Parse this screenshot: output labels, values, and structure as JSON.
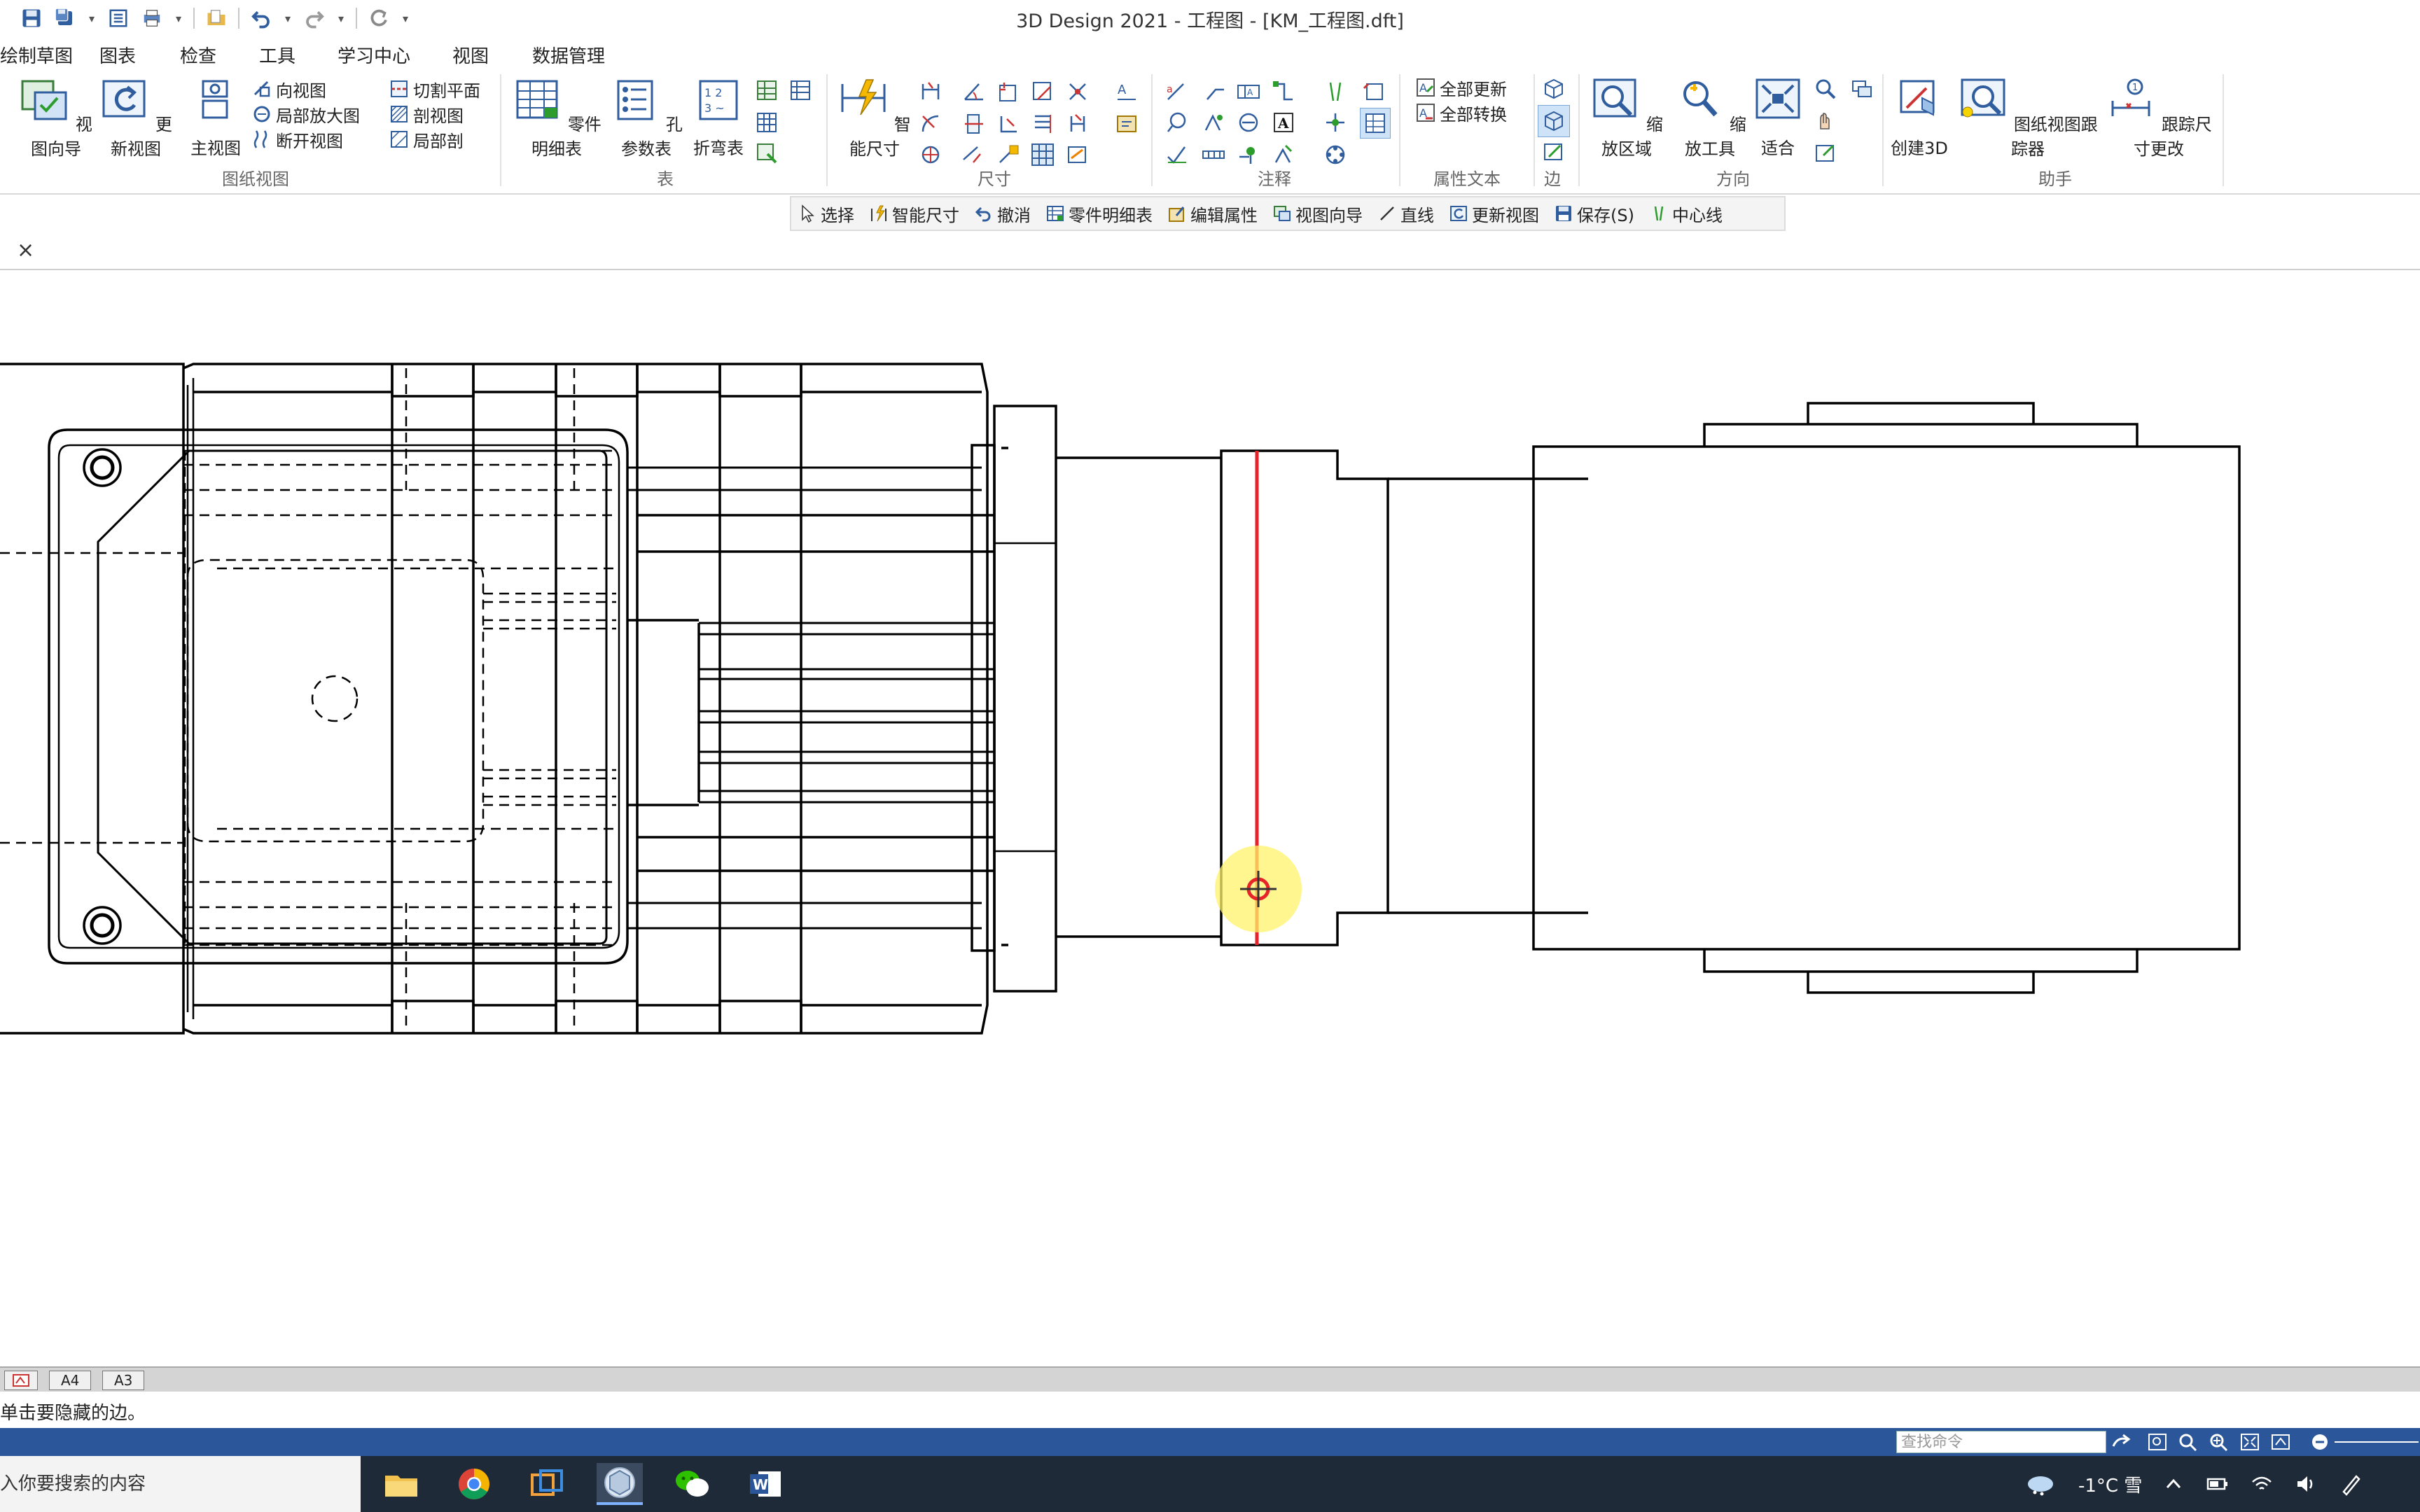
{
  "window": {
    "title": "3D Design 2021 - 工程图 - [KM_工程图.dft]"
  },
  "quick_access": {
    "icons": [
      "save-icon",
      "save-all-icon",
      "dropdown-icon",
      "properties-icon",
      "print-icon",
      "dropdown-icon",
      "folder-icon",
      "undo-icon",
      "dropdown-icon",
      "redo-icon",
      "dropdown-icon",
      "repeat-icon",
      "customize-icon"
    ]
  },
  "menu": {
    "items": [
      "绘制草图",
      "图表",
      "检查",
      "工具",
      "学习中心",
      "视图",
      "数据管理"
    ]
  },
  "ribbon": {
    "drawing_views": {
      "label": "图纸视图",
      "view_wizard": "视图向导",
      "update_views": "更新视图",
      "principal_view": "主视图",
      "auxiliary_view": "向视图",
      "detail_view": "局部放大图",
      "broken_view": "断开视图",
      "cutting_plane": "切割平面",
      "section_view": "剖视图",
      "partial_section": "局部剖"
    },
    "tables": {
      "label": "表",
      "parts_list": "零件明细表",
      "hole_table": "孔参数表",
      "bend_table": "折弯表"
    },
    "dimension": {
      "label": "尺寸",
      "smart_dimension": "智能尺寸"
    },
    "annotation": {
      "label": "注释"
    },
    "property_text": {
      "label": "属性文本",
      "update_all": "全部更新",
      "convert_all": "全部转换"
    },
    "edges": {
      "label": "边"
    },
    "orient": {
      "label": "方向",
      "zoom_area": "缩放区域",
      "zoom": "缩放工具",
      "fit": "适合"
    },
    "assistant": {
      "label": "助手",
      "create_3d": "创建3D",
      "view_tracker": "图纸视图跟踪器",
      "dimension_tracker": "跟踪尺寸更改"
    }
  },
  "command_bar": {
    "items": [
      {
        "label": "选择",
        "icon": "select-arrow-icon"
      },
      {
        "label": "智能尺寸",
        "icon": "smart-dimension-icon"
      },
      {
        "label": "撤消",
        "icon": "undo-icon"
      },
      {
        "label": "零件明细表",
        "icon": "parts-list-icon"
      },
      {
        "label": "编辑属性",
        "icon": "edit-properties-icon"
      },
      {
        "label": "视图向导",
        "icon": "view-wizard-icon"
      },
      {
        "label": "直线",
        "icon": "line-icon"
      },
      {
        "label": "更新视图",
        "icon": "update-view-icon"
      },
      {
        "label": "保存(S)",
        "icon": "save-icon"
      },
      {
        "label": "中心线",
        "icon": "centerline-icon"
      }
    ]
  },
  "document_tab": {
    "close_symbol": "×"
  },
  "sheets": {
    "tabs": [
      "A4",
      "A3"
    ]
  },
  "status": {
    "prompt": "单击要隐藏的边。",
    "command_search_placeholder": "查找命令"
  },
  "taskbar": {
    "search_text": "入你要搜索的内容",
    "apps": [
      "file-explorer-icon",
      "chrome-icon",
      "app-window-icon",
      "3d-design-icon",
      "wechat-icon",
      "word-icon"
    ],
    "weather": "-1°C 雪",
    "tray_icons": [
      "chevron-up-icon",
      "battery-icon",
      "wifi-icon",
      "volume-icon",
      "pen-icon"
    ]
  },
  "colors": {
    "accent": "#2b579a",
    "highlight_edge": "#e8242b",
    "cursor_halo": "#fff36a"
  }
}
